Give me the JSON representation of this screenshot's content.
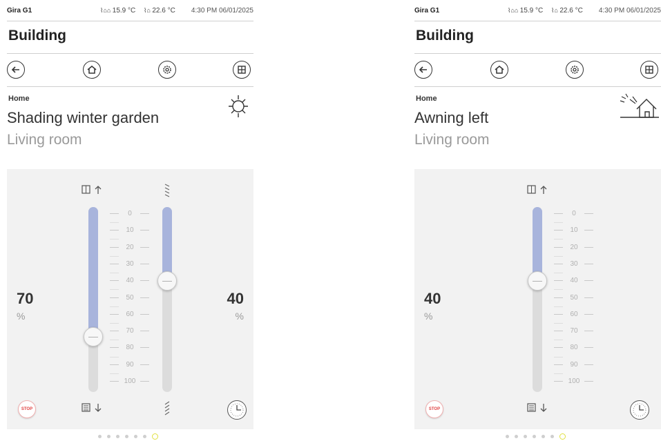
{
  "screens": [
    {
      "status": {
        "device": "Gira G1",
        "outdoor_temp": "15.9 °C",
        "indoor_temp": "22.6 °C",
        "time": "4:30 PM 06/01/2025"
      },
      "page_title": "Building",
      "nav": [
        "back-icon",
        "home-icon",
        "settings-icon",
        "grid-icon"
      ],
      "breadcrumb": "Home",
      "function_name": "Shading winter garden",
      "room": "Living room",
      "function_icon": "sun-icon",
      "position": {
        "value": "70",
        "unit": "%",
        "level_percent": 70
      },
      "slat": {
        "value": "40",
        "unit": "%",
        "level_percent": 40
      },
      "scale": [
        "0",
        "10",
        "20",
        "30",
        "40",
        "50",
        "60",
        "70",
        "80",
        "90",
        "100"
      ],
      "stop_label": "STOP",
      "accent_fill": "#a8b4dc",
      "page_dots": 7,
      "active_dot": 7
    },
    {
      "status": {
        "device": "Gira G1",
        "outdoor_temp": "15.9 °C",
        "indoor_temp": "22.6 °C",
        "time": "4:30 PM 06/01/2025"
      },
      "page_title": "Building",
      "nav": [
        "back-icon",
        "home-icon",
        "settings-icon",
        "grid-icon"
      ],
      "breadcrumb": "Home",
      "function_name": "Awning left",
      "room": "Living room",
      "function_icon": "awning-icon",
      "position": {
        "value": "40",
        "unit": "%",
        "level_percent": 40
      },
      "scale": [
        "0",
        "10",
        "20",
        "30",
        "40",
        "50",
        "60",
        "70",
        "80",
        "90",
        "100"
      ],
      "stop_label": "STOP",
      "accent_fill": "#a8b4dc",
      "page_dots": 7,
      "active_dot": 7
    }
  ]
}
